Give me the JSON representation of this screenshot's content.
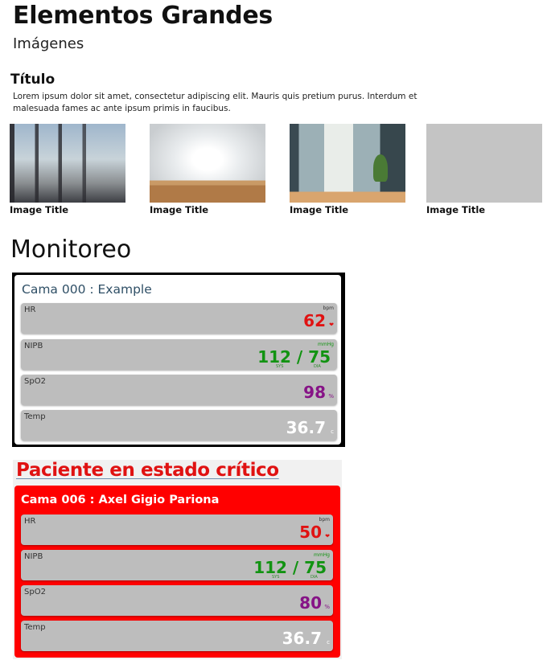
{
  "header": {
    "title": "Elementos Grandes",
    "subtitle": "Imágenes"
  },
  "section": {
    "title": "Título",
    "body": "Lorem ipsum dolor sit amet, consectetur adipiscing elit. Mauris quis pretium purus. Interdum et malesuada fames ac ante ipsum primis in faucibus."
  },
  "gallery": [
    {
      "caption": "Image Title"
    },
    {
      "caption": "Image Title"
    },
    {
      "caption": "Image Title"
    },
    {
      "caption": "Image Title"
    }
  ],
  "monitoring": {
    "heading": "Monitoreo",
    "card": {
      "bed": "Cama 000 : Example",
      "hr": {
        "label": "HR",
        "unit": "bpm",
        "value": "62",
        "icon": "heart-icon"
      },
      "nipb": {
        "label": "NIPB",
        "unit": "mmHg",
        "value": "112 / 75",
        "sys": "SYS",
        "dia": "DIA"
      },
      "spo2": {
        "label": "SpO2",
        "value": "98",
        "suffix": "%"
      },
      "temp": {
        "label": "Temp",
        "value": "36.7",
        "suffix": "c"
      }
    }
  },
  "critical": {
    "heading": "Paciente en estado crítico",
    "card": {
      "bed": "Cama 006 : Axel Gigio Pariona",
      "hr": {
        "label": "HR",
        "unit": "bpm",
        "value": "50",
        "icon": "heart-icon"
      },
      "nipb": {
        "label": "NIPB",
        "unit": "mmHg",
        "value": "112 / 75",
        "sys": "SYS",
        "dia": "DIA"
      },
      "spo2": {
        "label": "SpO2",
        "value": "80",
        "suffix": "%"
      },
      "temp": {
        "label": "Temp",
        "value": "36.7",
        "suffix": "c"
      }
    }
  },
  "colors": {
    "critical_bg": "#ff0000",
    "hr": "#e01212",
    "nipb": "#129312",
    "spo2": "#861386",
    "temp": "#ffffff"
  }
}
